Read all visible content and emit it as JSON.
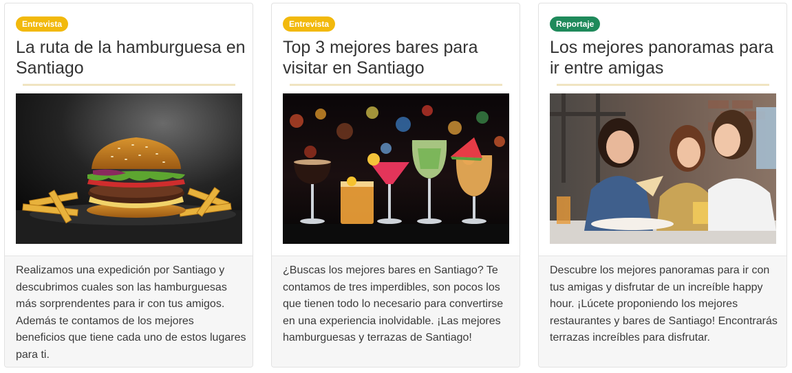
{
  "cards": [
    {
      "badge": "Entrevista",
      "badge_color": "#f2b90c",
      "title": "La ruta de la hamburguesa en Santiago",
      "image": "burger-photo",
      "excerpt": "Realizamos una expedición por Santiago y descubrimos cuales son las hamburguesas más sorprendentes para ir con tus amigos. Además te contamos de los mejores beneficios que tiene cada uno de estos lugares para ti."
    },
    {
      "badge": "Entrevista",
      "badge_color": "#f2b90c",
      "title": "Top 3 mejores bares para visitar en Santiago",
      "image": "cocktails-photo",
      "excerpt": "¿Buscas los mejores bares en Santiago? Te contamos de tres imperdibles, son pocos los que tienen todo lo necesario para convertirse en una experiencia inolvidable. ¡Las mejores hamburguesas y terrazas de Santiago!"
    },
    {
      "badge": "Reportaje",
      "badge_color": "#1f8a5b",
      "title": "Los mejores panoramas para ir entre amigas",
      "image": "friends-photo",
      "excerpt": "Descubre los mejores panoramas para ir con tus amigas y disfrutar de un increíble happy hour. ¡Lúcete proponiendo los mejores restaurantes y bares de Santiago! Encontrarás terrazas increíbles para disfrutar."
    }
  ]
}
